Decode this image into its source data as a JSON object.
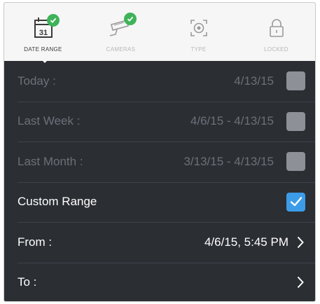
{
  "tabs": [
    {
      "label": "DATE RANGE",
      "icon": "calendar-icon",
      "calendar_day": "31",
      "checked": true,
      "active": true
    },
    {
      "label": "CAMERAS",
      "icon": "camera-icon",
      "checked": true,
      "active": false
    },
    {
      "label": "TYPE",
      "icon": "motion-target-icon",
      "checked": false,
      "active": false
    },
    {
      "label": "LOCKED",
      "icon": "lock-icon",
      "checked": false,
      "active": false
    }
  ],
  "rows": [
    {
      "label": "Today :",
      "value": "4/13/15",
      "control": "checkbox",
      "checked": false,
      "enabled": false
    },
    {
      "label": "Last Week :",
      "value": "4/6/15 - 4/13/15",
      "control": "checkbox",
      "checked": false,
      "enabled": false
    },
    {
      "label": "Last Month :",
      "value": "3/13/15 - 4/13/15",
      "control": "checkbox",
      "checked": false,
      "enabled": false
    },
    {
      "label": "Custom Range",
      "value": "",
      "control": "checkbox",
      "checked": true,
      "enabled": true
    },
    {
      "label": "From :",
      "value": "4/6/15, 5:45 PM",
      "control": "chevron",
      "enabled": true
    },
    {
      "label": "To :",
      "value": "",
      "control": "chevron",
      "enabled": true
    }
  ],
  "colors": {
    "panel_bg": "#2b2e33",
    "tab_bg": "#f6f6f6",
    "check_green": "#3fb35a",
    "checkbox_blue": "#3d9ce8",
    "checkbox_gray": "#8d9096",
    "dim_text": "#6d7078"
  }
}
